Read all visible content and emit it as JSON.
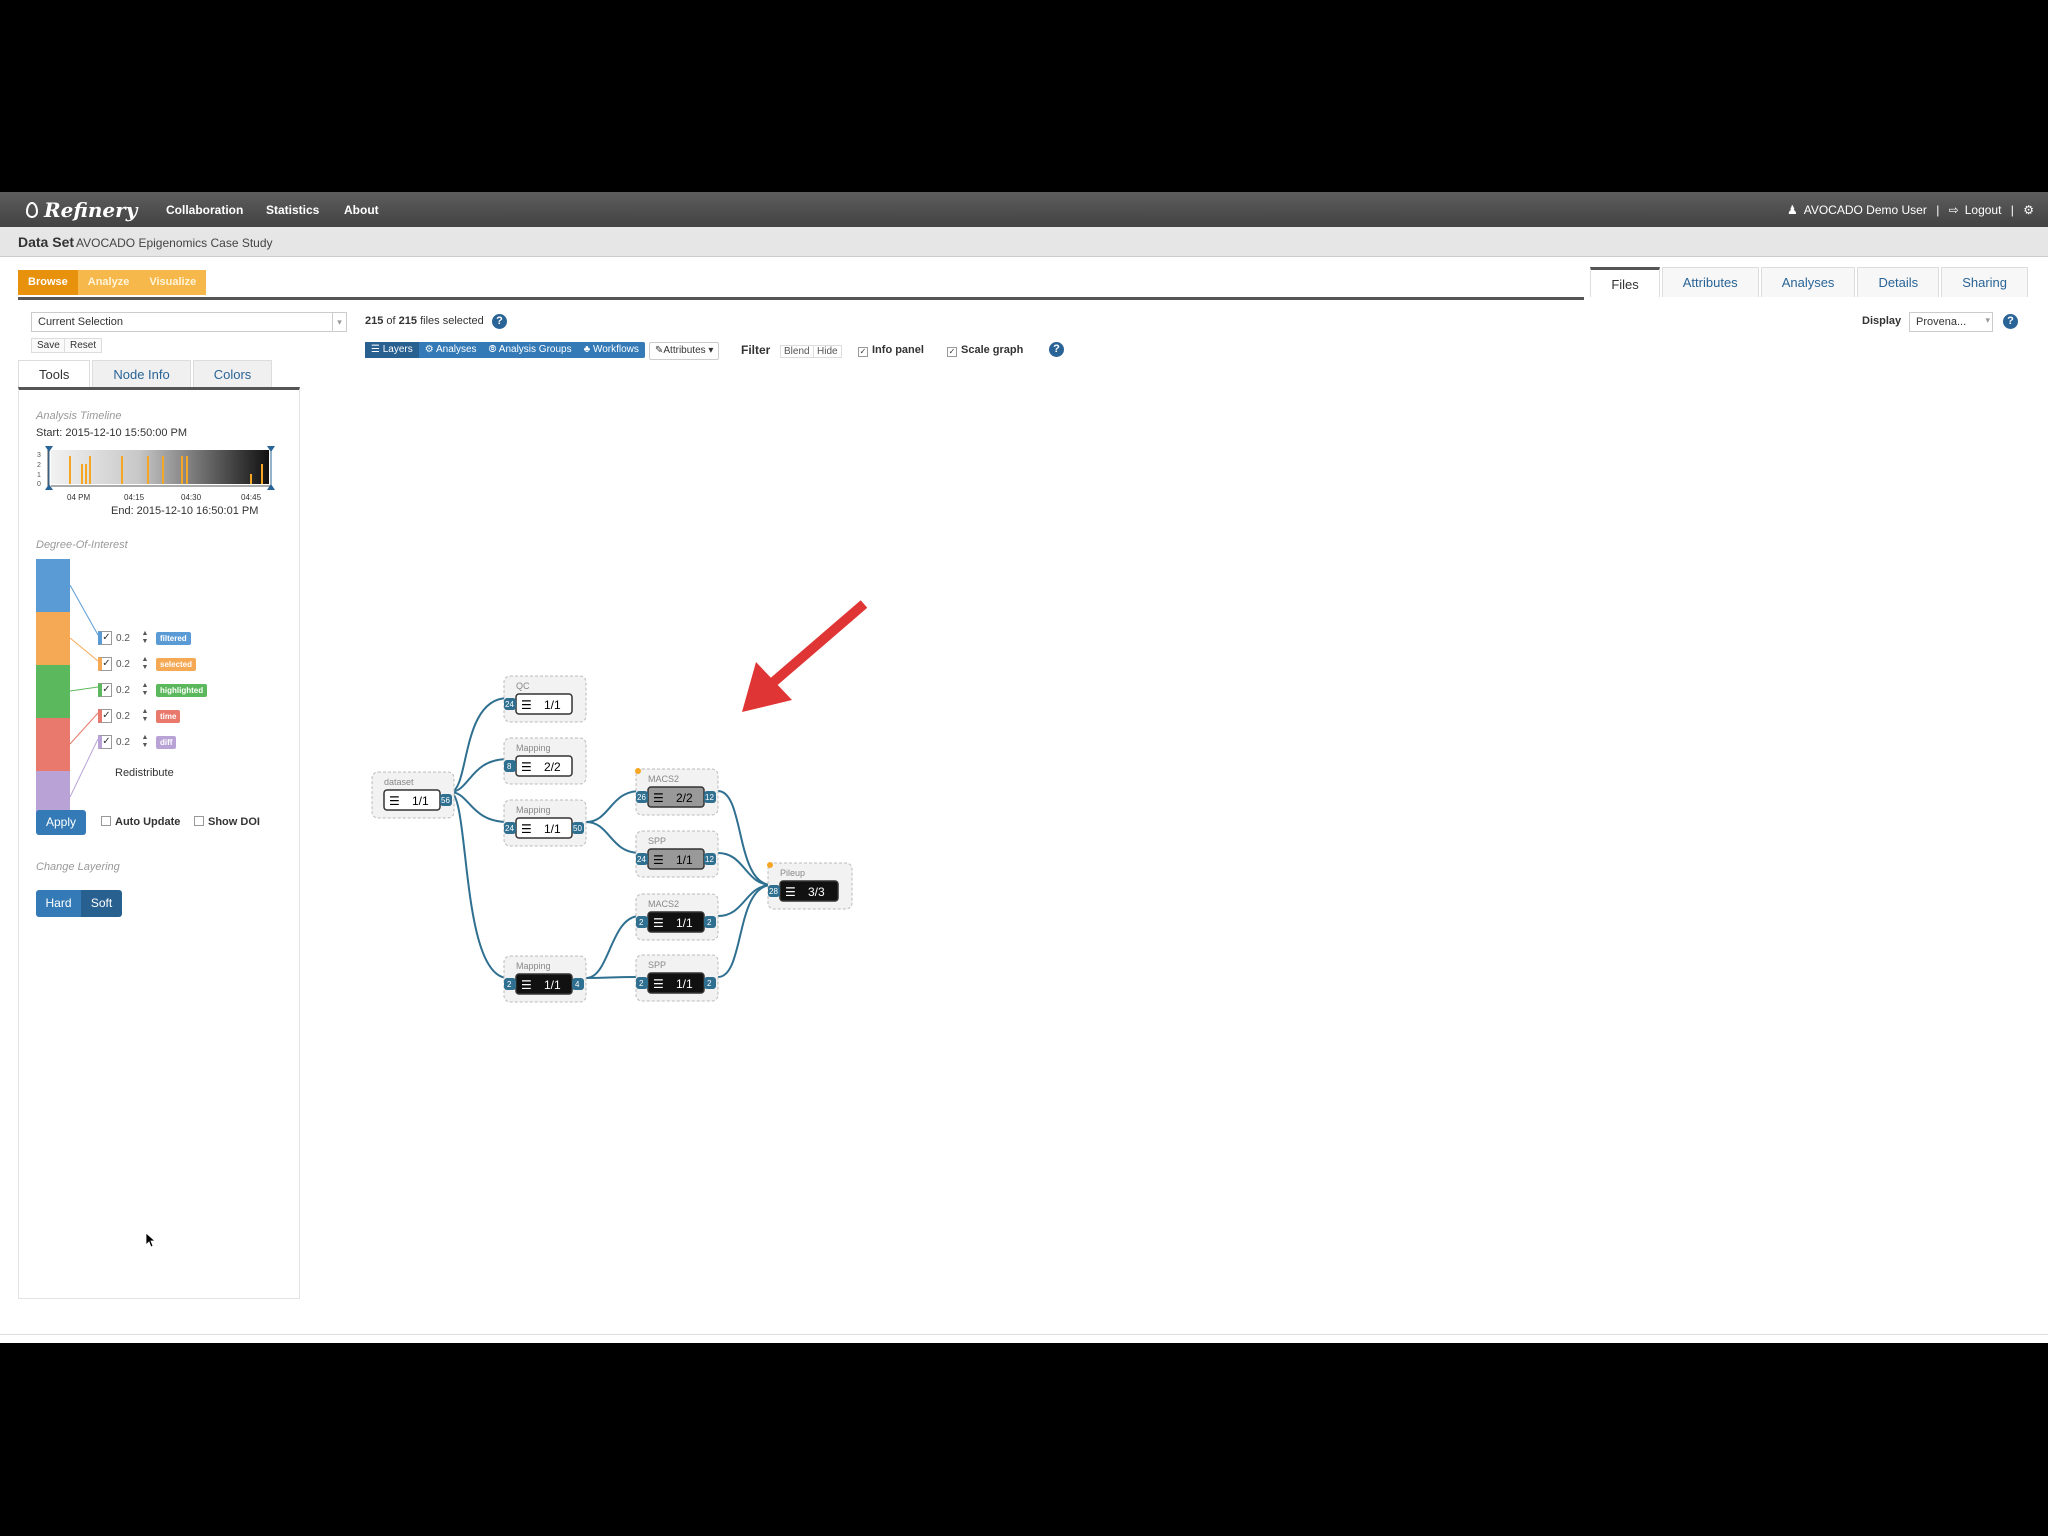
{
  "navbar": {
    "brand": "Refinery",
    "links": [
      "Collaboration",
      "Statistics",
      "About"
    ],
    "user": "AVOCADO Demo User",
    "logout": "Logout",
    "sep": "|"
  },
  "dataset": {
    "label": "Data Set",
    "name": "AVOCADO Epigenomics Case Study"
  },
  "modes": [
    "Browse",
    "Analyze",
    "Visualize"
  ],
  "right_tabs": [
    "Files",
    "Attributes",
    "Analyses",
    "Details",
    "Sharing"
  ],
  "selection": {
    "value": "Current Selection",
    "save": "Save",
    "reset": "Reset"
  },
  "left_tabs": [
    "Tools",
    "Node Info",
    "Colors"
  ],
  "timeline": {
    "title": "Analysis Timeline",
    "start": "Start: 2015-12-10 15:50:00 PM",
    "end": "End: 2015-12-10 16:50:01 PM",
    "ticks": [
      "04 PM",
      "04:15",
      "04:30",
      "04:45"
    ],
    "yticks": [
      "3",
      "2",
      "1",
      "0"
    ]
  },
  "doi": {
    "title": "Degree-Of-Interest",
    "rows": [
      {
        "value": "0.2",
        "tag": "filtered",
        "color": "#5b9bd5"
      },
      {
        "value": "0.2",
        "tag": "selected",
        "color": "#f6a954"
      },
      {
        "value": "0.2",
        "tag": "highlighted",
        "color": "#5cb85c"
      },
      {
        "value": "0.2",
        "tag": "time",
        "color": "#e8796c"
      },
      {
        "value": "0.2",
        "tag": "diff",
        "color": "#b9a3d6"
      }
    ],
    "redistribute": "Redistribute",
    "apply": "Apply",
    "auto_update": "Auto Update",
    "show_doi": "Show DOI"
  },
  "layering": {
    "title": "Change Layering",
    "hard": "Hard",
    "soft": "Soft"
  },
  "files": {
    "count": "215",
    "of": "of",
    "total": "215",
    "suffix": "files selected"
  },
  "toolbar": {
    "buttons": [
      "Layers",
      "Analyses",
      "Analysis Groups",
      "Workflows"
    ],
    "attributes": "Attributes",
    "filter": "Filter",
    "blend": "Blend",
    "hide": "Hide",
    "info_panel": "Info panel",
    "scale_graph": "Scale graph"
  },
  "display": {
    "label": "Display",
    "value": "Provena..."
  },
  "help": "?",
  "graph": {
    "nodes": [
      {
        "id": "dataset",
        "title": "dataset",
        "count": "1/1",
        "style": "white",
        "in": "",
        "out": "56"
      },
      {
        "id": "qc",
        "title": "QC",
        "count": "1/1",
        "style": "white",
        "in": "24",
        "out": ""
      },
      {
        "id": "map1",
        "title": "Mapping",
        "count": "2/2",
        "style": "white",
        "in": "8",
        "out": ""
      },
      {
        "id": "map2",
        "title": "Mapping",
        "count": "1/1",
        "style": "white",
        "in": "24",
        "out": "50"
      },
      {
        "id": "map3",
        "title": "Mapping",
        "count": "1/1",
        "style": "black",
        "in": "2",
        "out": "4"
      },
      {
        "id": "macs1",
        "title": "MACS2",
        "count": "2/2",
        "style": "gray",
        "in": "26",
        "out": "12"
      },
      {
        "id": "spp1",
        "title": "SPP",
        "count": "1/1",
        "style": "gray",
        "in": "24",
        "out": "12"
      },
      {
        "id": "macs2",
        "title": "MACS2",
        "count": "1/1",
        "style": "black",
        "in": "2",
        "out": "2"
      },
      {
        "id": "spp2",
        "title": "SPP",
        "count": "1/1",
        "style": "black",
        "in": "2",
        "out": "2"
      },
      {
        "id": "pileup",
        "title": "Pileup",
        "count": "3/3",
        "style": "black",
        "in": "28",
        "out": ""
      }
    ]
  }
}
